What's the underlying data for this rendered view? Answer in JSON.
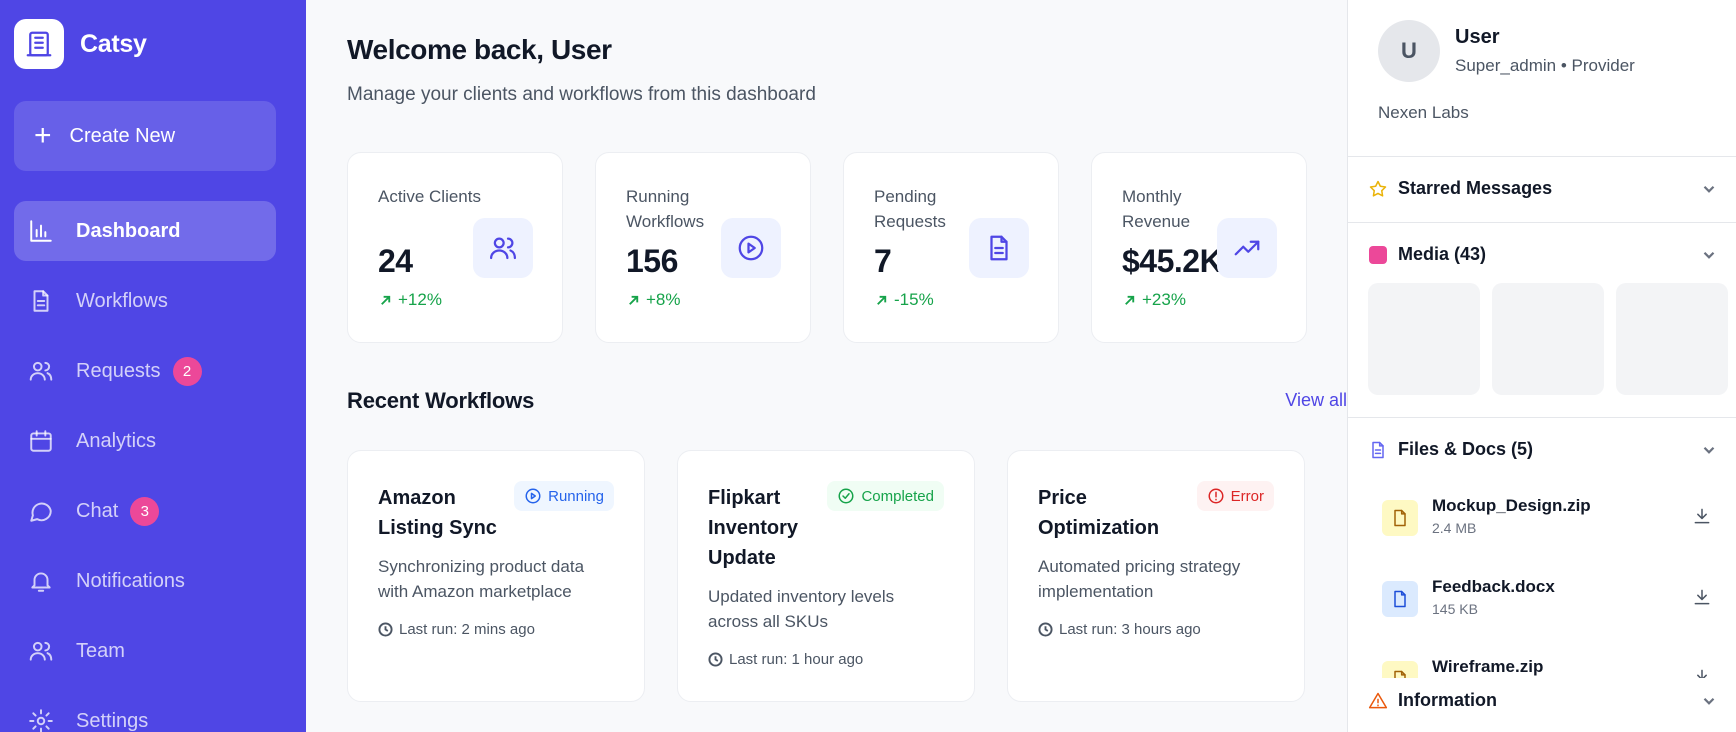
{
  "brand": {
    "name": "Catsy"
  },
  "sidebar": {
    "create_label": "Create New",
    "items": [
      {
        "label": "Dashboard",
        "icon": "bar-chart-icon",
        "active": true
      },
      {
        "label": "Workflows",
        "icon": "document-icon"
      },
      {
        "label": "Requests",
        "icon": "users-icon",
        "badge": "2"
      },
      {
        "label": "Analytics",
        "icon": "calendar-icon"
      },
      {
        "label": "Chat",
        "icon": "chat-icon",
        "badge": "3"
      },
      {
        "label": "Notifications",
        "icon": "bell-icon"
      },
      {
        "label": "Team",
        "icon": "users-icon"
      },
      {
        "label": "Settings",
        "icon": "gear-icon"
      }
    ],
    "badge_color": "#ec4899",
    "background": "#4f46e5"
  },
  "main": {
    "welcome": "Welcome back, User",
    "subtitle": "Manage your clients and workflows from this dashboard",
    "stats": [
      {
        "label": "Active Clients",
        "value": "24",
        "change": "+12%",
        "icon": "users-icon"
      },
      {
        "label": "Running Workflows",
        "value": "156",
        "change": "+8%",
        "icon": "play-circle-icon"
      },
      {
        "label": "Pending Requests",
        "value": "7",
        "change": "-15%",
        "icon": "document-icon"
      },
      {
        "label": "Monthly Revenue",
        "value": "$45.2K",
        "change": "+23%",
        "icon": "trending-up-icon"
      }
    ],
    "recent_title": "Recent Workflows",
    "view_all": "View all",
    "workflows": [
      {
        "title": "Amazon Listing Sync",
        "status": "Running",
        "status_icon": "play-circle-icon",
        "description": "Synchronizing product data with Amazon marketplace",
        "last_run": "Last run: 2 mins ago"
      },
      {
        "title": "Flipkart Inventory Update",
        "status": "Completed",
        "status_icon": "check-circle-icon",
        "description": "Updated inventory levels across all SKUs",
        "last_run": "Last run: 1 hour ago"
      },
      {
        "title": "Price Optimization",
        "status": "Error",
        "status_icon": "alert-circle-icon",
        "description": "Automated pricing strategy implementation",
        "last_run": "Last run: 3 hours ago"
      }
    ]
  },
  "panel": {
    "avatar_initial": "U",
    "name": "User",
    "role": "Super_admin • Provider",
    "org": "Nexen Labs",
    "starred_label": "Starred Messages",
    "media_label": "Media (43)",
    "files_label": "Files & Docs (5)",
    "info_label": "Information",
    "files": [
      {
        "name": "Mockup_Design.zip",
        "size": "2.4 MB",
        "kind": "zip"
      },
      {
        "name": "Feedback.docx",
        "size": "145 KB",
        "kind": "doc"
      },
      {
        "name": "Wireframe.zip",
        "size": "",
        "kind": "zip"
      }
    ]
  }
}
